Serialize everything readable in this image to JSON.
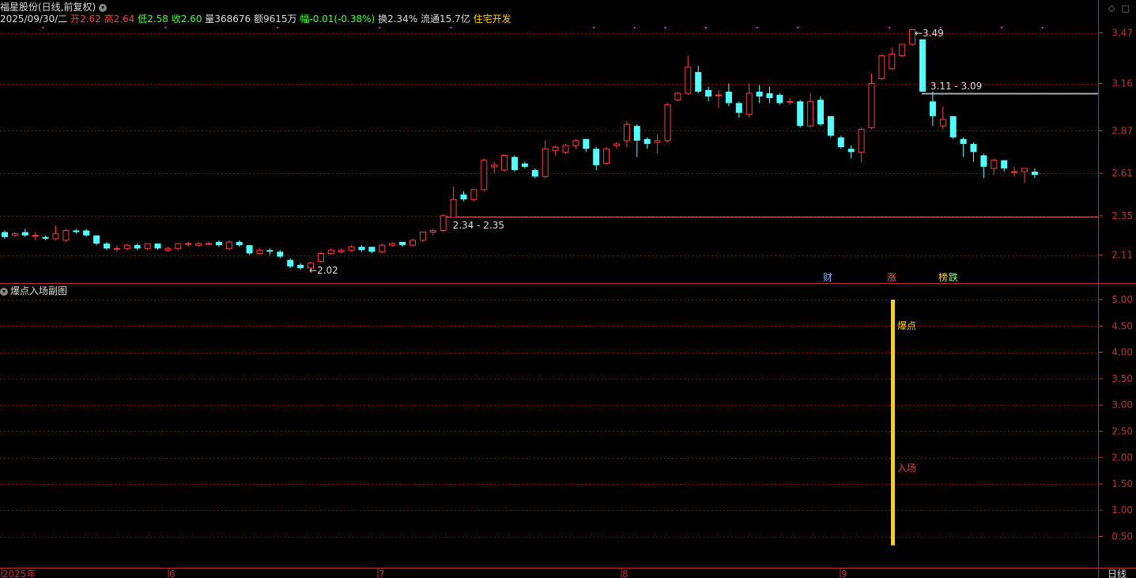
{
  "main_title": "福星股份(日线,前复权)",
  "info_bar": {
    "date": "2025/09/30/二",
    "open_label": "开",
    "open": "2.62",
    "high_label": "高",
    "high": "2.64",
    "low_label": "低",
    "low": "2.58",
    "close_label": "收",
    "close": "2.60",
    "volume_label": "量",
    "volume": "368676",
    "amount_label": "额",
    "amount": "9615万",
    "change_label": "幅",
    "change": "-0.01(-0.38%)",
    "turnover_label": "换",
    "turnover": "2.34%",
    "float_label": "流通",
    "float_value": "15.7亿",
    "sector": "住宅开发"
  },
  "sub_title": "爆点入场副图",
  "colors": {
    "up": "#ff3d3d",
    "down": "#54ffff",
    "grid": "#8b0000",
    "axis": "#c03030",
    "label": "#ccc",
    "signal": "#ffd000",
    "tag_blue": "#7fb0ff",
    "tag_red": "#ff5050",
    "tag_green": "#80ff80",
    "tag_yellow": "#ffd000"
  },
  "main_axis_ticks": [
    "3.47",
    "3.16",
    "2.87",
    "2.61",
    "2.35",
    "2.11"
  ],
  "sub_axis_ticks": [
    "5.00",
    "4.50",
    "4.00",
    "3.50",
    "3.00",
    "2.50",
    "2.00",
    "1.50",
    "1.00",
    "0.50"
  ],
  "x_axis": [
    "2025年",
    "6",
    "7",
    "8",
    "9"
  ],
  "period_label": "日线",
  "annotations": {
    "max_label": "3.49",
    "min_label": "2.02",
    "range_high": "3.11 - 3.09",
    "range_low": "2.34 - 2.35"
  },
  "event_tags": [
    "财",
    "涨",
    "榜",
    "跌"
  ],
  "signals": {
    "top_label": "爆点",
    "bottom_label": "入场"
  },
  "chart_data": {
    "type": "candlestick",
    "ylim": [
      2.0,
      3.5
    ],
    "sub_ylim": [
      0,
      5
    ],
    "candles": [
      [
        2.25,
        2.22,
        2.26,
        2.21
      ],
      [
        2.23,
        2.24,
        2.25,
        2.22
      ],
      [
        2.25,
        2.23,
        2.27,
        2.22
      ],
      [
        2.23,
        2.23,
        2.25,
        2.2
      ],
      [
        2.22,
        2.21,
        2.23,
        2.2
      ],
      [
        2.21,
        2.24,
        2.29,
        2.2
      ],
      [
        2.2,
        2.26,
        2.27,
        2.19
      ],
      [
        2.26,
        2.25,
        2.27,
        2.24
      ],
      [
        2.26,
        2.23,
        2.27,
        2.22
      ],
      [
        2.23,
        2.18,
        2.23,
        2.17
      ],
      [
        2.18,
        2.15,
        2.19,
        2.14
      ],
      [
        2.15,
        2.15,
        2.17,
        2.13
      ],
      [
        2.15,
        2.17,
        2.18,
        2.14
      ],
      [
        2.17,
        2.15,
        2.18,
        2.14
      ],
      [
        2.15,
        2.18,
        2.18,
        2.14
      ],
      [
        2.18,
        2.15,
        2.18,
        2.14
      ],
      [
        2.14,
        2.15,
        2.16,
        2.13
      ],
      [
        2.15,
        2.18,
        2.18,
        2.14
      ],
      [
        2.18,
        2.18,
        2.19,
        2.16
      ],
      [
        2.17,
        2.18,
        2.19,
        2.16
      ],
      [
        2.18,
        2.18,
        2.19,
        2.17
      ],
      [
        2.19,
        2.17,
        2.2,
        2.16
      ],
      [
        2.15,
        2.19,
        2.2,
        2.14
      ],
      [
        2.19,
        2.17,
        2.2,
        2.16
      ],
      [
        2.17,
        2.12,
        2.17,
        2.11
      ],
      [
        2.12,
        2.14,
        2.15,
        2.11
      ],
      [
        2.14,
        2.13,
        2.15,
        2.11
      ],
      [
        2.13,
        2.1,
        2.14,
        2.09
      ],
      [
        2.08,
        2.04,
        2.09,
        2.03
      ],
      [
        2.05,
        2.03,
        2.06,
        2.02
      ],
      [
        2.03,
        2.06,
        2.07,
        2.02
      ],
      [
        2.07,
        2.12,
        2.13,
        2.06
      ],
      [
        2.12,
        2.14,
        2.15,
        2.11
      ],
      [
        2.13,
        2.14,
        2.15,
        2.12
      ],
      [
        2.14,
        2.16,
        2.17,
        2.13
      ],
      [
        2.16,
        2.14,
        2.17,
        2.13
      ],
      [
        2.16,
        2.13,
        2.16,
        2.12
      ],
      [
        2.13,
        2.17,
        2.18,
        2.12
      ],
      [
        2.17,
        2.18,
        2.19,
        2.16
      ],
      [
        2.19,
        2.17,
        2.19,
        2.16
      ],
      [
        2.17,
        2.2,
        2.21,
        2.16
      ],
      [
        2.2,
        2.25,
        2.25,
        2.19
      ],
      [
        2.25,
        2.26,
        2.27,
        2.23
      ],
      [
        2.26,
        2.35,
        2.36,
        2.25
      ],
      [
        2.34,
        2.45,
        2.53,
        2.34
      ],
      [
        2.48,
        2.45,
        2.5,
        2.44
      ],
      [
        2.45,
        2.51,
        2.51,
        2.44
      ],
      [
        2.51,
        2.69,
        2.7,
        2.5
      ],
      [
        2.65,
        2.66,
        2.68,
        2.61
      ],
      [
        2.63,
        2.72,
        2.72,
        2.62
      ],
      [
        2.71,
        2.63,
        2.72,
        2.62
      ],
      [
        2.67,
        2.65,
        2.68,
        2.64
      ],
      [
        2.63,
        2.59,
        2.64,
        2.58
      ],
      [
        2.59,
        2.76,
        2.81,
        2.58
      ],
      [
        2.75,
        2.77,
        2.78,
        2.72
      ],
      [
        2.74,
        2.78,
        2.79,
        2.73
      ],
      [
        2.78,
        2.81,
        2.82,
        2.76
      ],
      [
        2.82,
        2.76,
        2.82,
        2.74
      ],
      [
        2.76,
        2.66,
        2.77,
        2.63
      ],
      [
        2.67,
        2.76,
        2.77,
        2.66
      ],
      [
        2.78,
        2.79,
        2.8,
        2.76
      ],
      [
        2.81,
        2.91,
        2.93,
        2.77
      ],
      [
        2.9,
        2.81,
        2.91,
        2.71
      ],
      [
        2.82,
        2.79,
        2.83,
        2.76
      ],
      [
        2.8,
        2.81,
        2.85,
        2.73
      ],
      [
        2.81,
        3.03,
        3.04,
        2.8
      ],
      [
        3.06,
        3.1,
        3.11,
        3.05
      ],
      [
        3.1,
        3.26,
        3.33,
        3.09
      ],
      [
        3.23,
        3.11,
        3.27,
        3.1
      ],
      [
        3.12,
        3.08,
        3.14,
        3.05
      ],
      [
        3.09,
        3.09,
        3.12,
        3.01
      ],
      [
        3.11,
        3.04,
        3.16,
        3.02
      ],
      [
        3.04,
        2.98,
        3.05,
        2.95
      ],
      [
        2.97,
        3.1,
        3.16,
        2.95
      ],
      [
        3.11,
        3.08,
        3.15,
        3.04
      ],
      [
        3.1,
        3.07,
        3.14,
        3.04
      ],
      [
        3.09,
        3.04,
        3.1,
        3.03
      ],
      [
        3.05,
        3.05,
        3.07,
        3.03
      ],
      [
        3.05,
        2.9,
        3.06,
        2.89
      ],
      [
        2.9,
        3.05,
        3.1,
        2.89
      ],
      [
        3.06,
        2.91,
        3.08,
        2.9
      ],
      [
        2.96,
        2.84,
        2.96,
        2.83
      ],
      [
        2.83,
        2.77,
        2.84,
        2.76
      ],
      [
        2.76,
        2.74,
        2.78,
        2.7
      ],
      [
        2.74,
        2.88,
        2.89,
        2.68
      ],
      [
        2.89,
        3.16,
        3.22,
        2.88
      ],
      [
        3.19,
        3.33,
        3.34,
        3.18
      ],
      [
        3.25,
        3.34,
        3.38,
        3.24
      ],
      [
        3.33,
        3.4,
        3.4,
        3.32
      ],
      [
        3.4,
        3.49,
        3.49,
        3.39
      ],
      [
        3.43,
        3.11,
        3.43,
        3.11
      ],
      [
        3.05,
        2.96,
        3.11,
        2.9
      ],
      [
        2.9,
        2.94,
        3.02,
        2.88
      ],
      [
        2.96,
        2.83,
        2.96,
        2.82
      ],
      [
        2.82,
        2.79,
        2.83,
        2.71
      ],
      [
        2.79,
        2.74,
        2.8,
        2.68
      ],
      [
        2.72,
        2.65,
        2.73,
        2.58
      ],
      [
        2.64,
        2.69,
        2.7,
        2.6
      ],
      [
        2.69,
        2.64,
        2.69,
        2.62
      ],
      [
        2.62,
        2.62,
        2.65,
        2.59
      ],
      [
        2.62,
        2.64,
        2.64,
        2.55
      ],
      [
        2.62,
        2.6,
        2.64,
        2.58
      ]
    ],
    "signal": {
      "index": 84,
      "value": 5.0
    }
  }
}
